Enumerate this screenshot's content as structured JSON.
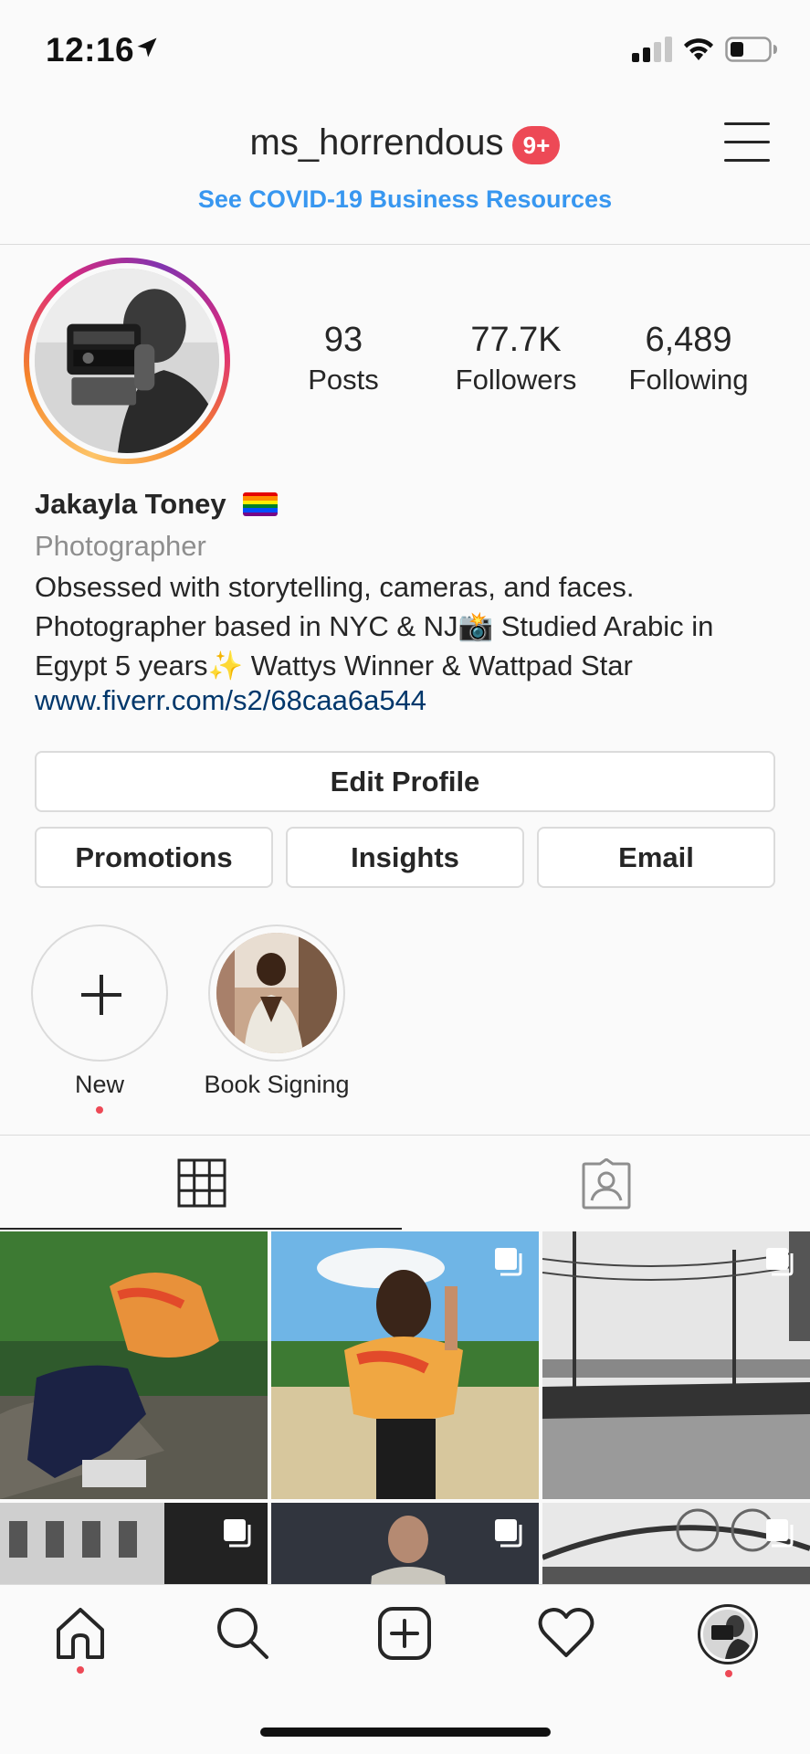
{
  "status_bar": {
    "time": "12:16"
  },
  "header": {
    "username": "ms_horrendous",
    "notification_badge": "9+",
    "covid_link": "See COVID-19 Business Resources"
  },
  "profile": {
    "stats": [
      {
        "value": "93",
        "label": "Posts"
      },
      {
        "value": "77.7K",
        "label": "Followers"
      },
      {
        "value": "6,489",
        "label": "Following"
      }
    ],
    "name": "Jakayla Toney",
    "category": "Photographer",
    "bio": "Obsessed with storytelling, cameras, and faces. Photographer based in NYC & NJ📸 Studied Arabic in Egypt 5 years✨ Wattys Winner & Wattpad Star",
    "link": "www.fiverr.com/s2/68caa6a544"
  },
  "buttons": {
    "edit_profile": "Edit Profile",
    "promotions": "Promotions",
    "insights": "Insights",
    "email": "Email"
  },
  "highlights": [
    {
      "label": "New"
    },
    {
      "label": "Book Signing"
    }
  ],
  "tabs": {
    "active": "grid"
  },
  "colors": {
    "accent_link": "#3897f0",
    "badge": "#ed4956",
    "bio_link": "#00376b"
  },
  "icons": {
    "nav": [
      "home-icon",
      "search-icon",
      "new-post-icon",
      "activity-heart-icon",
      "profile-avatar"
    ]
  }
}
